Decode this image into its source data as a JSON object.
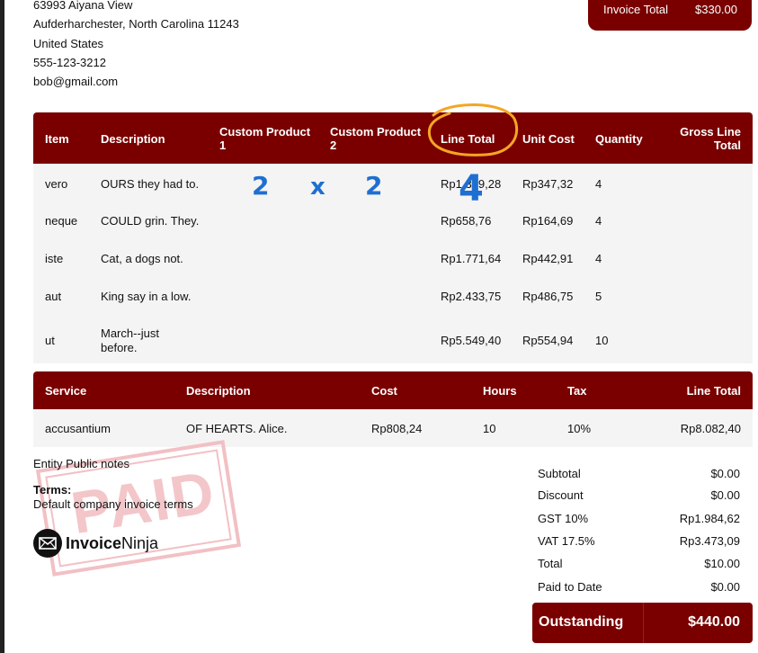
{
  "client": {
    "address1": "63993 Aiyana View",
    "address2": "Aufderharchester, North Carolina 11243",
    "country": "United States",
    "phone": "555-123-3212",
    "email": "bob@gmail.com"
  },
  "invoice_total": {
    "label": "Invoice Total",
    "value": "$330.00"
  },
  "products": {
    "headers": [
      "Item",
      "Description",
      "Custom Product 1",
      "Custom Product 2",
      "Line Total",
      "Unit Cost",
      "Quantity",
      "Gross Line Total"
    ],
    "rows": [
      {
        "item": "vero",
        "description": "OURS they had to.",
        "line_total": "Rp1.389,28",
        "unit_cost": "Rp347,32",
        "quantity": "4"
      },
      {
        "item": "neque",
        "description": "COULD grin. They.",
        "line_total": "Rp658,76",
        "unit_cost": "Rp164,69",
        "quantity": "4"
      },
      {
        "item": "iste",
        "description": "Cat, a dogs not.",
        "line_total": "Rp1.771,64",
        "unit_cost": "Rp442,91",
        "quantity": "4"
      },
      {
        "item": "aut",
        "description": "King say in a low.",
        "line_total": "Rp2.433,75",
        "unit_cost": "Rp486,75",
        "quantity": "5"
      },
      {
        "item": "ut",
        "description": "March--just before.",
        "line_total": "Rp5.549,40",
        "unit_cost": "Rp554,94",
        "quantity": "10"
      }
    ]
  },
  "services": {
    "headers": [
      "Service",
      "Description",
      "Cost",
      "Hours",
      "Tax",
      "Line Total"
    ],
    "rows": [
      {
        "service": "accusantium",
        "description": "OF HEARTS. Alice.",
        "cost": "Rp808,24",
        "hours": "10",
        "tax": "10%",
        "line_total": "Rp8.082,40"
      }
    ]
  },
  "notes": "Entity Public notes",
  "terms_label": "Terms:",
  "terms": "Default company invoice terms",
  "stamp": "PAID",
  "logo": {
    "bold": "Invoice",
    "light": "Ninja",
    "icon": "envelope-icon"
  },
  "totals": [
    {
      "label": "Subtotal",
      "value": "$0.00"
    },
    {
      "label": "Discount",
      "value": "$0.00"
    },
    {
      "label": "GST 10%",
      "value": "Rp1.984,62"
    },
    {
      "label": "VAT 17.5%",
      "value": "Rp3.473,09"
    },
    {
      "label": "Total",
      "value": "$10.00"
    },
    {
      "label": "Paid to Date",
      "value": "$0.00"
    }
  ],
  "outstanding": {
    "label": "Outstanding",
    "value": "$440.00"
  },
  "handwriting": {
    "a": "2",
    "op": "x",
    "b": "2",
    "result": "4"
  },
  "colors": {
    "accent": "#7a0000",
    "row_bg": "#f4f4f4",
    "stamp": "#f2c0c4",
    "highlight": "#f5a623",
    "ink": "#1f6fd1"
  }
}
